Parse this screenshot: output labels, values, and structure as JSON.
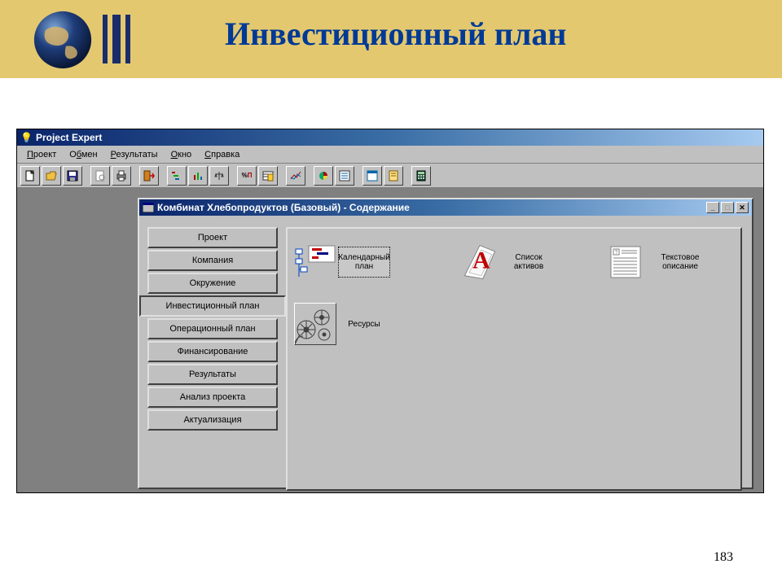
{
  "slide": {
    "title": "Инвестиционный план",
    "page_number": "183"
  },
  "app": {
    "title": "Project Expert",
    "menu": {
      "project": "Проект",
      "exchange": "Обмен",
      "results": "Результаты",
      "window": "Окно",
      "help": "Справка"
    },
    "child_title": "Комбинат Хлебопродуктов (Базовый) - Содержание",
    "tabs": {
      "0": "Проект",
      "1": "Компания",
      "2": "Окружение",
      "3": "Инвестиционный план",
      "4": "Операционный план",
      "5": "Финансирование",
      "6": "Результаты",
      "7": "Анализ проекта",
      "8": "Актуализация"
    },
    "content": {
      "calendar_plan": "Календарный план",
      "asset_list": "Список активов",
      "text_desc": "Текстовое описание",
      "resources": "Ресурсы"
    }
  }
}
